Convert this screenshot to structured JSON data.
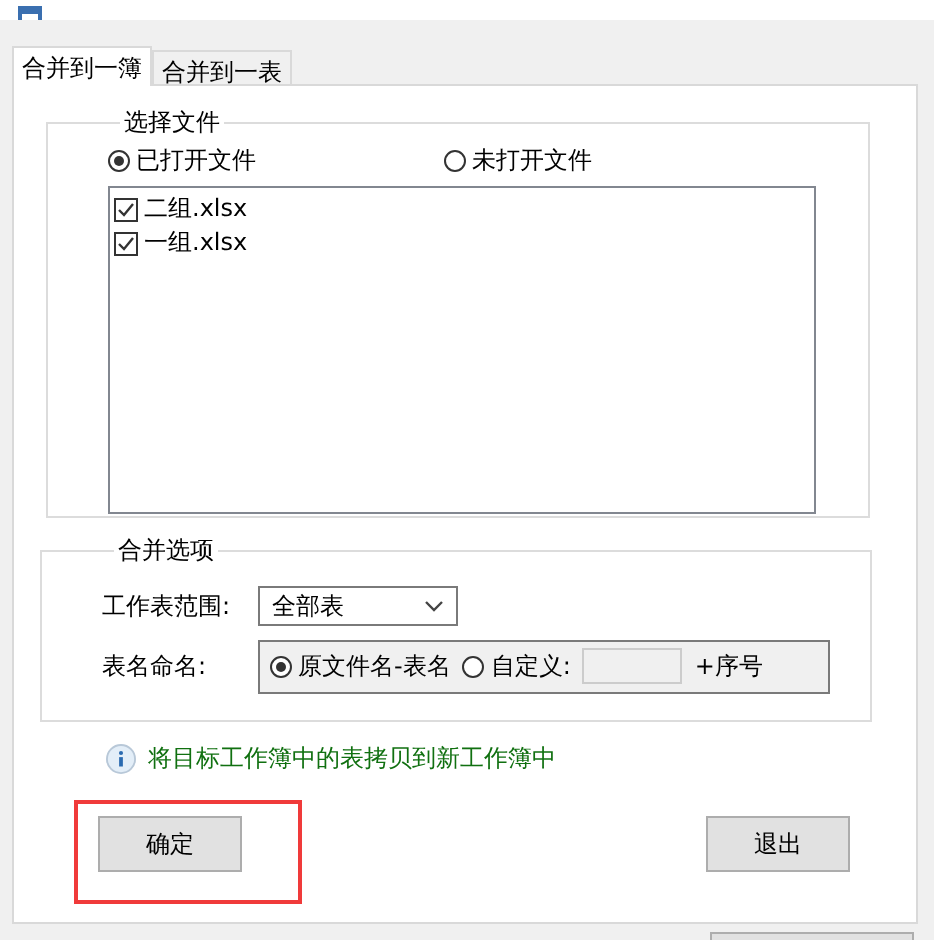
{
  "tabs": [
    {
      "label": "合并到一簿",
      "selected": true
    },
    {
      "label": "合并到一表",
      "selected": false
    }
  ],
  "select_files": {
    "title": "选择文件",
    "sources": [
      {
        "label": "已打开文件",
        "selected": true
      },
      {
        "label": "未打开文件",
        "selected": false
      }
    ],
    "files": [
      {
        "name": "二组.xlsx",
        "checked": true
      },
      {
        "name": "一组.xlsx",
        "checked": true
      }
    ]
  },
  "merge_options": {
    "title": "合并选项",
    "range_label": "工作表范围:",
    "range_value": "全部表",
    "naming_label": "表名命名:",
    "naming_options": [
      {
        "label": "原文件名-表名",
        "selected": true
      },
      {
        "label": "自定义:",
        "selected": false
      }
    ],
    "suffix": "+序号"
  },
  "info": "将目标工作簿中的表拷贝到新工作簿中",
  "buttons": [
    {
      "label": "确定",
      "highlighted": true
    },
    {
      "label": "退出",
      "highlighted": false
    }
  ]
}
